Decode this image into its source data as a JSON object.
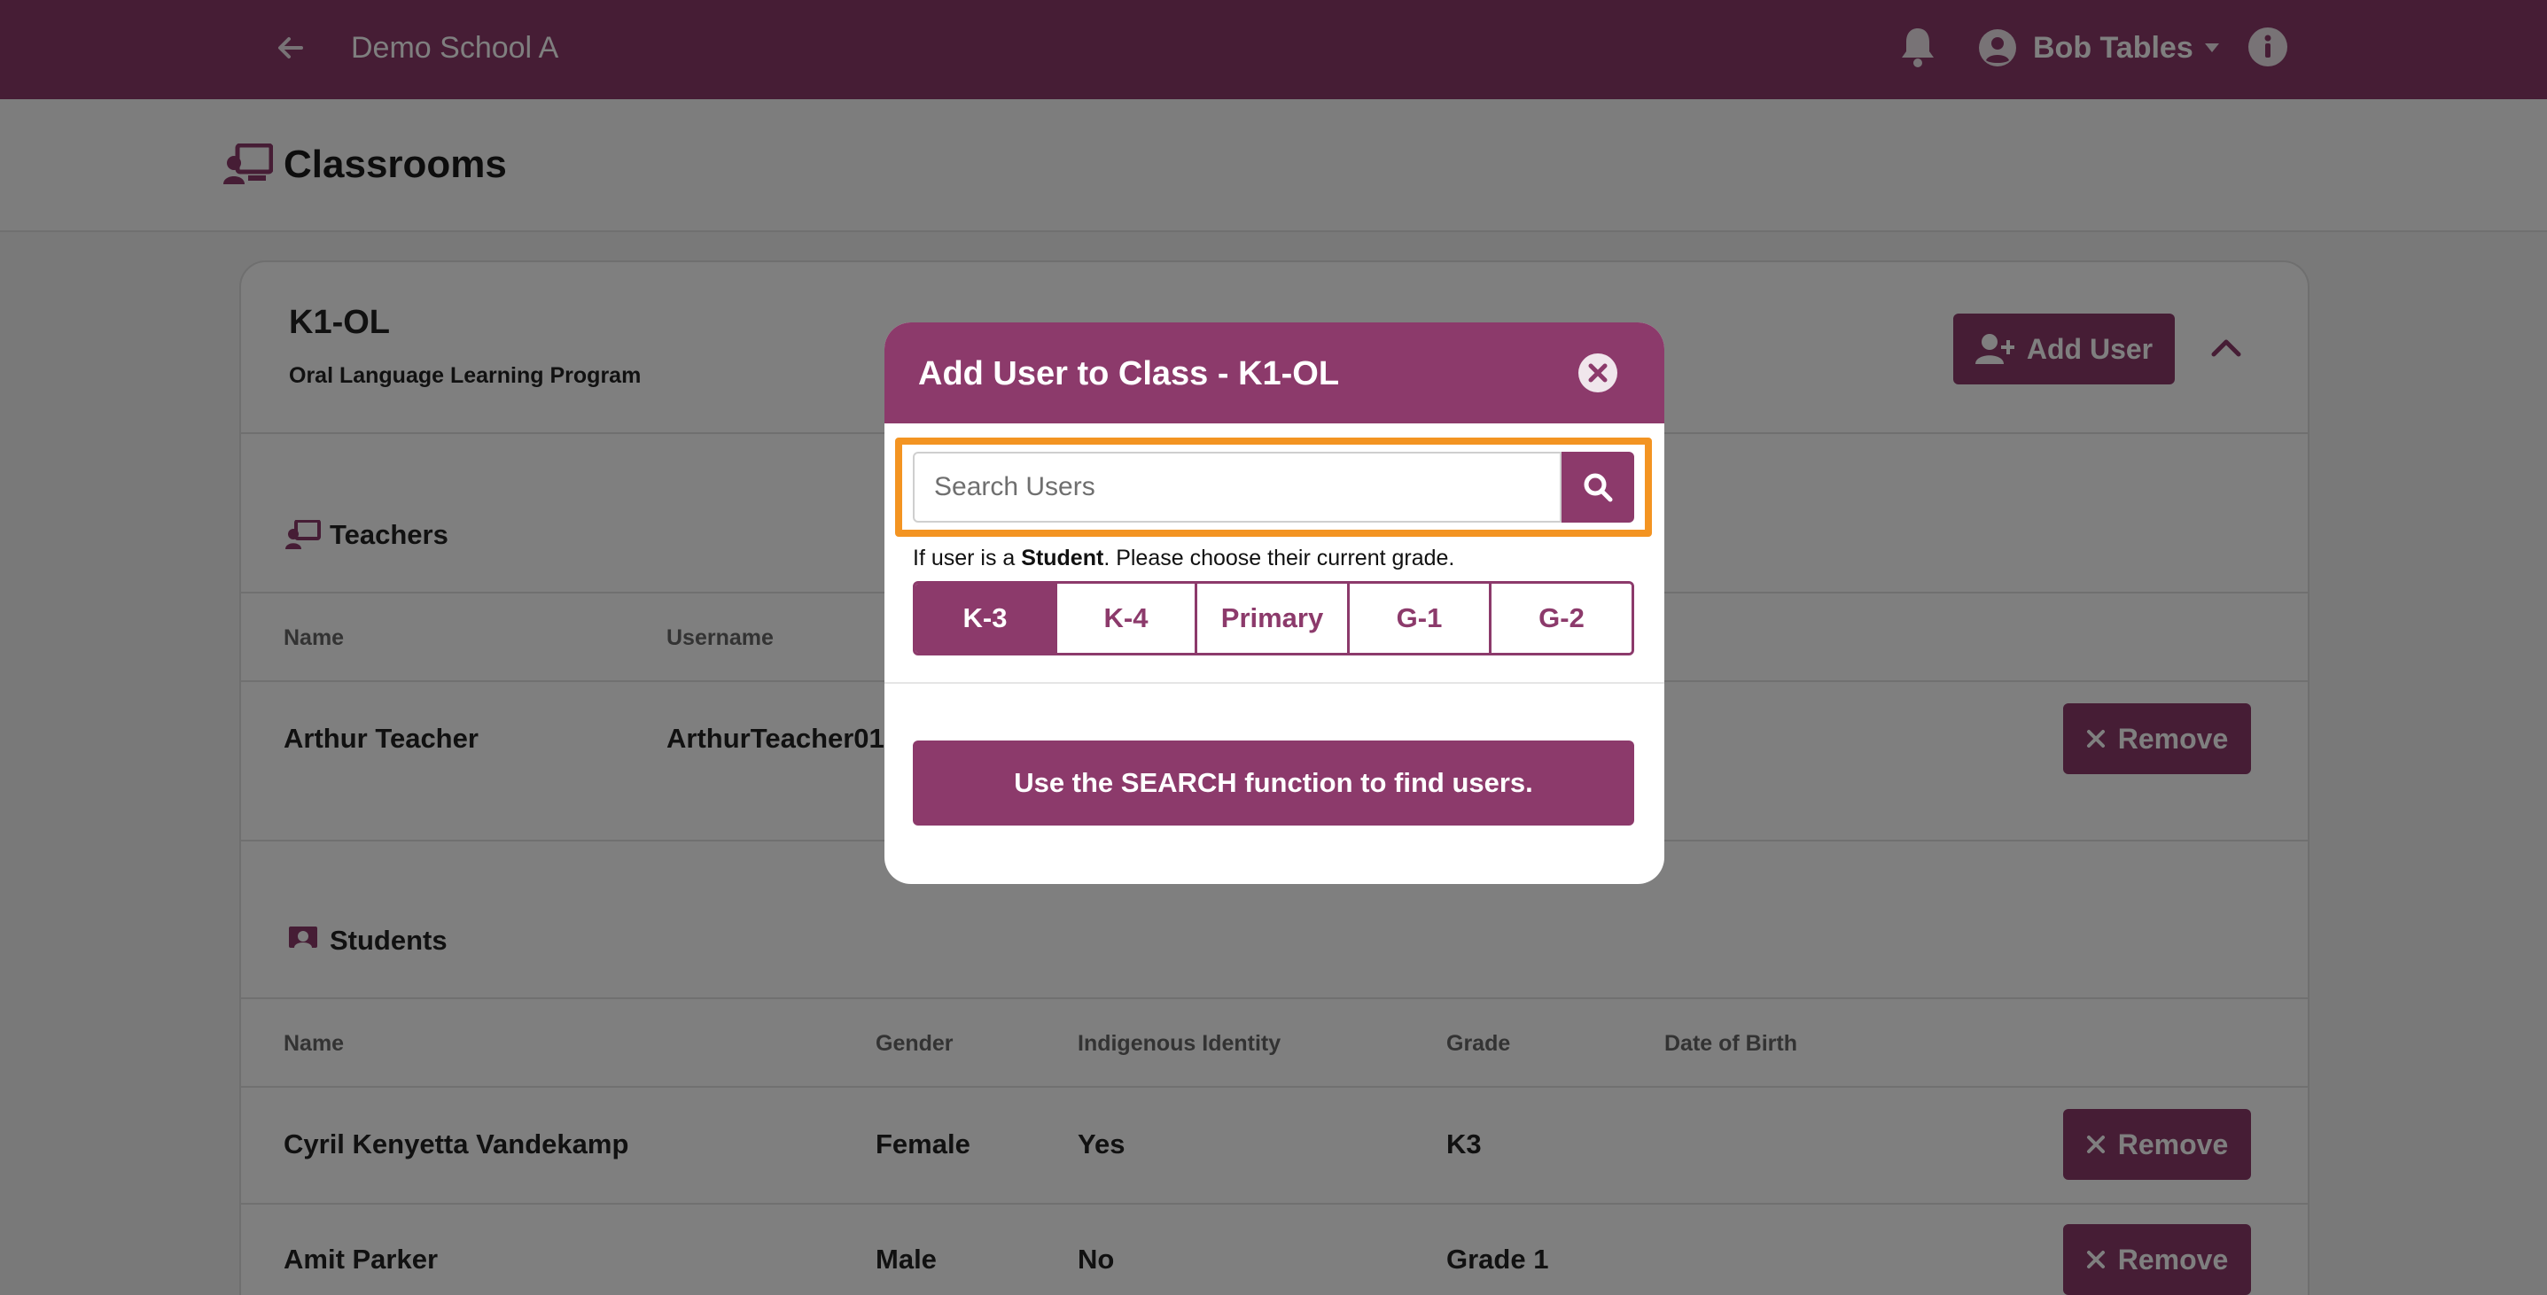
{
  "topbar": {
    "school_name": "Demo School A",
    "user_name": "Bob Tables"
  },
  "page": {
    "title": "Classrooms"
  },
  "class": {
    "name": "K1-OL",
    "description": "Oral Language Learning Program",
    "add_user_label": "Add User"
  },
  "teachers": {
    "title": "Teachers",
    "columns": [
      "Name",
      "Username"
    ],
    "rows": [
      {
        "name": "Arthur Teacher",
        "username": "ArthurTeacher01",
        "remove_label": "Remove"
      }
    ]
  },
  "students": {
    "title": "Students",
    "columns": [
      "Name",
      "Gender",
      "Indigenous Identity",
      "Grade",
      "Date of Birth"
    ],
    "rows": [
      {
        "name": "Cyril Kenyetta Vandekamp",
        "gender": "Female",
        "indigenous": "Yes",
        "grade": "K3",
        "remove_label": "Remove"
      },
      {
        "name": "Amit Parker",
        "gender": "Male",
        "indigenous": "No",
        "grade": "Grade 1",
        "remove_label": "Remove"
      }
    ]
  },
  "modal": {
    "title": "Add User to Class - K1-OL",
    "search_placeholder": "Search Users",
    "note_prefix": "If user is a ",
    "note_bold": "Student",
    "note_suffix": ". Please choose their current grade.",
    "grades": [
      "K-3",
      "K-4",
      "Primary",
      "G-1",
      "G-2"
    ],
    "selected_grade": "K-3",
    "hint": "Use the SEARCH function to find users."
  },
  "colors": {
    "brand": "#8c3a6b",
    "highlight": "#f39422"
  }
}
